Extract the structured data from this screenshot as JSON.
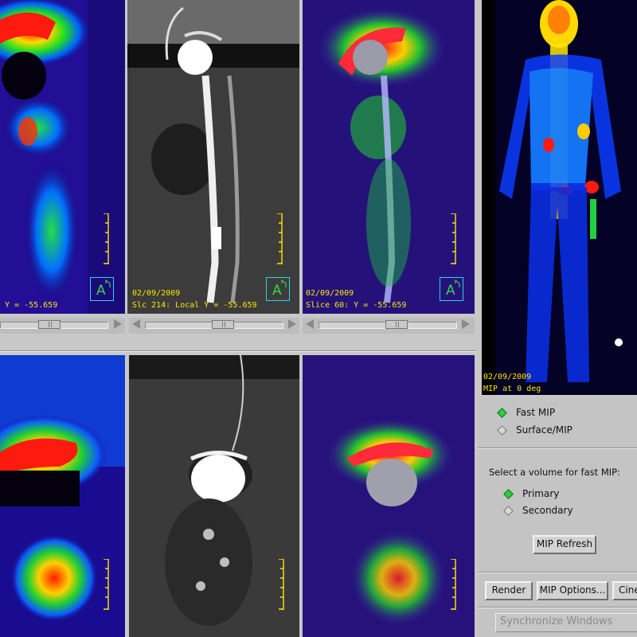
{
  "viewports": {
    "pet_top": {
      "info": "Y = -55.659"
    },
    "ct_top": {
      "date": "02/09/2009",
      "info": "Slc 214: Local Y = -55.659"
    },
    "fused_top": {
      "date": "02/09/2009",
      "info": "Slice 60: Y = -55.659"
    },
    "mip": {
      "date": "02/09/2009",
      "info": "MIP at 0 deg"
    }
  },
  "orientation_badge_label": "A",
  "mip_mode": {
    "options": [
      {
        "label": "Fast MIP",
        "selected": true
      },
      {
        "label": "Surface/MIP",
        "selected": false
      }
    ]
  },
  "volume_select": {
    "prompt": "Select a volume for fast MIP:",
    "options": [
      {
        "label": "Primary",
        "selected": true
      },
      {
        "label": "Secondary",
        "selected": false
      }
    ]
  },
  "buttons": {
    "mip_refresh": "MIP Refresh",
    "render": "Render",
    "mip_options": "MIP Options...",
    "cine": "Cine"
  },
  "sync_label": "Synchronize Windows",
  "colors": {
    "ui_gray": "#c8c8c8",
    "overlay_text": "#ffe600",
    "badge_cyan": "#2ad3e8",
    "radio_on": "#2fcf3a"
  }
}
